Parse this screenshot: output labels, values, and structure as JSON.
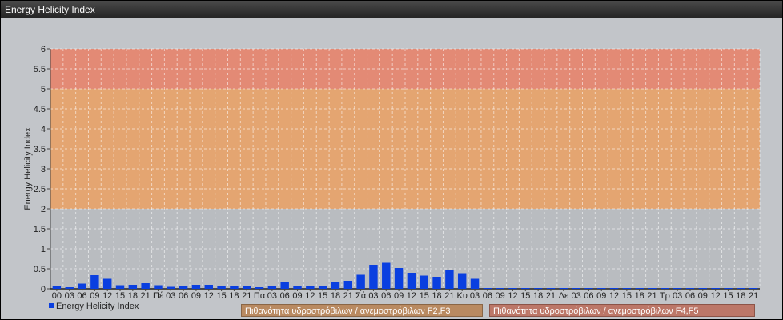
{
  "window": {
    "title": "Energy Helicity Index"
  },
  "chart_data": {
    "type": "bar",
    "ylabel": "Energy Helicity Index",
    "ylim": [
      0,
      6
    ],
    "yticks": [
      0,
      0.5,
      1,
      1.5,
      2,
      2.5,
      3,
      3.5,
      4,
      4.5,
      5,
      5.5,
      6
    ],
    "categories": [
      "00",
      "03",
      "06",
      "09",
      "12",
      "15",
      "18",
      "21",
      "Πέ",
      "03",
      "06",
      "09",
      "12",
      "15",
      "18",
      "21",
      "Πα",
      "03",
      "06",
      "09",
      "12",
      "15",
      "18",
      "21",
      "Σά",
      "03",
      "06",
      "09",
      "12",
      "15",
      "18",
      "21",
      "Κυ",
      "03",
      "06",
      "09",
      "12",
      "15",
      "18",
      "21",
      "Δε",
      "03",
      "06",
      "09",
      "12",
      "15",
      "18",
      "21",
      "Τρ",
      "03",
      "06",
      "09",
      "12",
      "15",
      "18",
      "21"
    ],
    "series": [
      {
        "name": "Energy Helicity Index",
        "color": "#0a3fe0",
        "values": [
          0.07,
          0.04,
          0.13,
          0.34,
          0.25,
          0.09,
          0.1,
          0.14,
          0.09,
          0.05,
          0.08,
          0.1,
          0.1,
          0.08,
          0.07,
          0.08,
          0.04,
          0.08,
          0.16,
          0.07,
          0.06,
          0.07,
          0.16,
          0.2,
          0.35,
          0.6,
          0.65,
          0.52,
          0.4,
          0.33,
          0.3,
          0.47,
          0.39,
          0.25,
          0.02,
          0.02,
          0.02,
          0.02,
          0.02,
          0.02,
          0.02,
          0.02,
          0.02,
          0.02,
          0.02,
          0.02,
          0.02,
          0.02,
          0.02,
          0.02,
          0.02,
          0.02,
          0.02,
          0.02,
          0.02,
          0.02
        ]
      }
    ],
    "bands": [
      {
        "from": 2,
        "to": 5,
        "color": "#e4a571",
        "label": "Πιθανότητα υδροστρόβιλων / ανεμοστρόβιλων F2,F3"
      },
      {
        "from": 5,
        "to": 6,
        "color": "#e38a75",
        "label": "Πιθανότητα υδροστρόβιλων / ανεμοστρόβιλων F4,F5"
      }
    ],
    "grid": true,
    "legend": "bottom-left"
  }
}
